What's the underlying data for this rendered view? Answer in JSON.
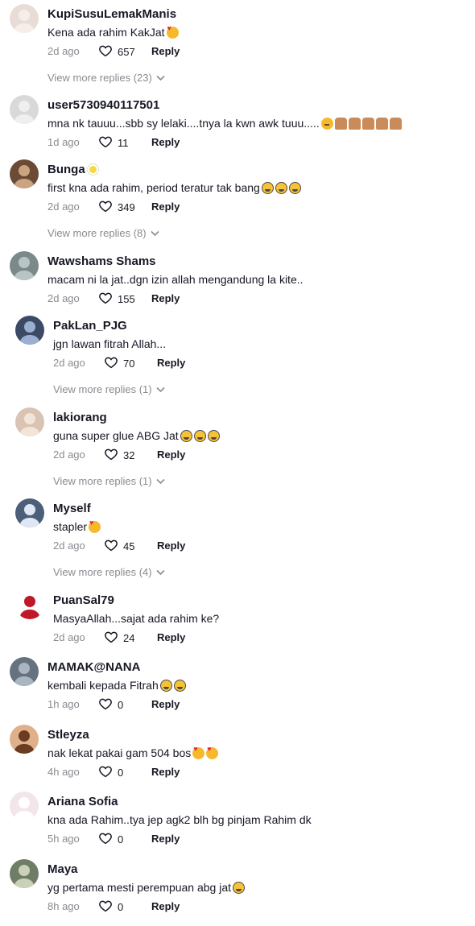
{
  "labels": {
    "reply": "Reply"
  },
  "comments": [
    {
      "username": "KupiSusuLemakManis",
      "text": "Kena ada rahim KakJat",
      "emojis": [
        "love"
      ],
      "time": "2d ago",
      "likes": "657",
      "more": "View more replies (23)"
    },
    {
      "username": "user5730940117501",
      "text": "mna nk tauuu...sbb sy lelaki....tnya la kwn awk tuuu.....",
      "emojis": [
        "think",
        "person",
        "person",
        "person",
        "person",
        "person"
      ],
      "time": "1d ago",
      "likes": "11",
      "more": ""
    },
    {
      "username": "Bunga",
      "text": "first kna ada rahim, period teratur tak bang",
      "emojis": [
        "laugh",
        "laugh",
        "laugh"
      ],
      "name_emoji": "flower",
      "time": "2d ago",
      "likes": "349",
      "more": "View more replies (8)"
    },
    {
      "username": "Wawshams Shams",
      "text": "macam ni la jat..dgn izin allah mengandung la kite..",
      "emojis": [],
      "time": "2d ago",
      "likes": "155",
      "more": ""
    },
    {
      "username": "PakLan_PJG",
      "text": "jgn lawan fitrah Allah...",
      "emojis": [],
      "time": "2d ago",
      "likes": "70",
      "more": "View more replies (1)"
    },
    {
      "username": "lakiorang",
      "text": "guna super glue ABG Jat",
      "emojis": [
        "laugh",
        "laugh",
        "laugh"
      ],
      "time": "2d ago",
      "likes": "32",
      "more": "View more replies (1)"
    },
    {
      "username": "Myself",
      "text": "stapler",
      "emojis": [
        "love"
      ],
      "time": "2d ago",
      "likes": "45",
      "more": "View more replies (4)"
    },
    {
      "username": "PuanSal79",
      "text": "MasyaAllah...sajat ada rahim ke?",
      "emojis": [],
      "time": "2d ago",
      "likes": "24",
      "more": ""
    },
    {
      "username": "MAMAK@NANA",
      "text": "kembali kepada Fitrah",
      "emojis": [
        "laugh",
        "laugh"
      ],
      "time": "1h ago",
      "likes": "0",
      "more": ""
    },
    {
      "username": "Stleyza",
      "text": "nak lekat pakai gam 504 bos",
      "emojis": [
        "love",
        "love"
      ],
      "time": "4h ago",
      "likes": "0",
      "more": ""
    },
    {
      "username": "Ariana Sofia",
      "text": "kna ada Rahim..tya jep agk2 blh bg pinjam Rahim dk",
      "emojis": [],
      "time": "5h ago",
      "likes": "0",
      "more": ""
    },
    {
      "username": "Maya",
      "text": "yg pertama mesti perempuan abg jat",
      "emojis": [
        "laugh"
      ],
      "time": "8h ago",
      "likes": "0",
      "more": ""
    }
  ],
  "colors": {
    "text": "#161823",
    "muted": "#8a8b91",
    "background": "#ffffff"
  }
}
